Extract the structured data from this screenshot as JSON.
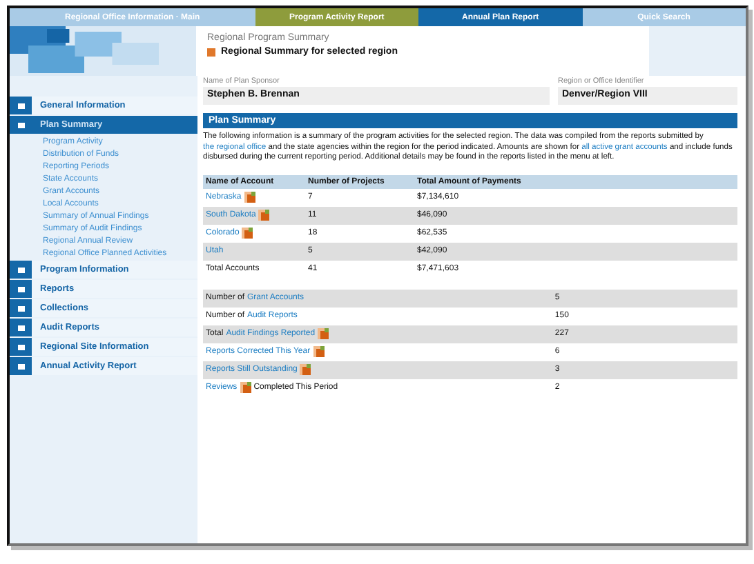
{
  "top_tabs": [
    {
      "label": "Regional Office Information · Main",
      "color": "#a9cbe6"
    },
    {
      "label": "Program Activity Report",
      "color": "#8e9c3c"
    },
    {
      "label": "Annual Plan Report",
      "color": "#1468a8"
    },
    {
      "label": "Quick Search",
      "color": "#a9cbe6"
    }
  ],
  "header": {
    "title": "Regional Program Summary",
    "subtitle": "Regional Summary for selected region"
  },
  "fields": [
    {
      "label": "Name of Plan Sponsor",
      "value": "Stephen B. Brennan"
    },
    {
      "label": "Region or Office Identifier",
      "value": "Denver/Region VIII"
    }
  ],
  "sidebar": {
    "items": [
      {
        "label": "General Information",
        "selected": false
      },
      {
        "label": "Plan Summary",
        "selected": true,
        "children": [
          {
            "label": "Program Activity"
          },
          {
            "label": "Distribution of Funds"
          },
          {
            "label": "Reporting Periods"
          },
          {
            "label": "State Accounts"
          },
          {
            "label": "Grant Accounts"
          },
          {
            "label": "Local Accounts"
          },
          {
            "label": "Summary of Annual Findings"
          },
          {
            "label": "Summary of Audit Findings"
          },
          {
            "label": "Regional Annual Review"
          },
          {
            "label": "Regional Office Planned Activities"
          }
        ]
      },
      {
        "label": "Program Information",
        "selected": false
      },
      {
        "label": "Reports",
        "selected": false
      },
      {
        "label": "Collections",
        "selected": false
      },
      {
        "label": "Audit Reports",
        "selected": false
      },
      {
        "label": "Regional Site Information",
        "selected": false
      },
      {
        "label": "Annual Activity Report",
        "selected": false
      }
    ]
  },
  "section": {
    "title": "Plan Summary",
    "paragraph": [
      {
        "kind": "text",
        "text": "The following information is a summary of the program activities for the selected region. The data was compiled from the reports submitted by "
      },
      {
        "kind": "link",
        "text": "the regional office"
      },
      {
        "kind": "text",
        "text": " and the state agencies within the region for the period indicated. Amounts are shown for "
      },
      {
        "kind": "link",
        "text": "all active grant accounts"
      },
      {
        "kind": "text",
        "text": " and include funds disbursed during the current reporting period. Additional details may be found in the reports listed in the menu at left."
      }
    ]
  },
  "table": {
    "columns": [
      "Name of Account",
      "Number of Projects",
      "Total Amount of Payments"
    ],
    "rows": [
      {
        "name": "Nebraska",
        "link": true,
        "flagged": true,
        "count": "7",
        "amount": "$7,134,610"
      },
      {
        "name": "South Dakota",
        "link": true,
        "flagged": true,
        "count": "11",
        "amount": "$46,090"
      },
      {
        "name": "Colorado",
        "link": true,
        "flagged": true,
        "count": "18",
        "amount": "$62,535"
      },
      {
        "name": "Utah",
        "link": true,
        "flagged": false,
        "count": "5",
        "amount": "$42,090"
      },
      {
        "name": "Total Accounts",
        "link": false,
        "flagged": false,
        "count": "41",
        "amount": "$7,471,603"
      }
    ]
  },
  "summary": {
    "rows": [
      {
        "prefix": "Number of ",
        "link": "Grant Accounts",
        "flagged": false,
        "value": "5"
      },
      {
        "prefix": "Number of ",
        "link": "Audit Reports",
        "flagged": false,
        "value": "150"
      },
      {
        "prefix": "Total ",
        "link": "Audit Findings Reported",
        "flagged": true,
        "value": "227"
      },
      {
        "link": "Reports Corrected This Year",
        "flagged": true,
        "value": "6"
      },
      {
        "link": "Reports Still Outstanding",
        "flagged": true,
        "value": "3"
      },
      {
        "link": "Reviews",
        "suffix": " Completed This Period",
        "flagged": true,
        "value": "2"
      }
    ]
  }
}
